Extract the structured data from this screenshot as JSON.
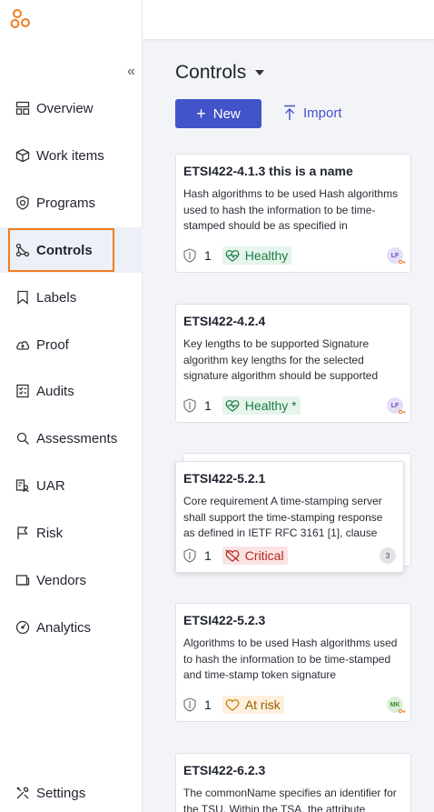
{
  "sidebar": {
    "collapse_label": "«",
    "items": [
      {
        "key": "overview",
        "label": "Overview",
        "icon": "overview-icon"
      },
      {
        "key": "work-items",
        "label": "Work items",
        "icon": "box-icon"
      },
      {
        "key": "programs",
        "label": "Programs",
        "icon": "shield-icon"
      },
      {
        "key": "controls",
        "label": "Controls",
        "icon": "controls-icon",
        "active": true
      },
      {
        "key": "labels",
        "label": "Labels",
        "icon": "bookmark-icon"
      },
      {
        "key": "proof",
        "label": "Proof",
        "icon": "cloud-icon"
      },
      {
        "key": "audits",
        "label": "Audits",
        "icon": "checklist-icon"
      },
      {
        "key": "assessments",
        "label": "Assessments",
        "icon": "search-icon"
      },
      {
        "key": "uar",
        "label": "UAR",
        "icon": "uar-icon"
      },
      {
        "key": "risk",
        "label": "Risk",
        "icon": "flag-icon"
      },
      {
        "key": "vendors",
        "label": "Vendors",
        "icon": "vendors-icon"
      },
      {
        "key": "analytics",
        "label": "Analytics",
        "icon": "analytics-icon"
      },
      {
        "key": "settings",
        "label": "Settings",
        "icon": "settings-icon"
      }
    ]
  },
  "main": {
    "title": "Controls",
    "new_label": "New",
    "import_label": "Import"
  },
  "cards": [
    {
      "title": "ETSI422-4.1.3 this is a name",
      "desc": "Hash algorithms to be used Hash algorithms used to hash the information to be time-stamped should be as specified in",
      "count": "1",
      "status": "Healthy",
      "avatar": "LF"
    },
    {
      "title": "ETSI422-4.2.4",
      "desc": "Key lengths to be supported Signature algorithm key lengths for the selected signature algorithm should be supported",
      "count": "1",
      "status": "Healthy *",
      "avatar": "LF"
    },
    {
      "title": "ETSI422-5.2.1",
      "desc": "Core requirement A time-stamping server shall support the time-stamping response as defined in IETF RFC 3161 [1], clause",
      "count": "1",
      "status": "Critical",
      "avatar": "3"
    },
    {
      "title": "ETSI422-5.2.3",
      "desc": "Algorithms to be used Hash algorithms used to hash the information to be time-stamped and time-stamp token signature",
      "count": "1",
      "status": "At risk",
      "avatar": "MK"
    },
    {
      "title": "ETSI422-6.2.3",
      "desc": "The commonName specifies an identifier for the TSU. Within the TSA, the attribute"
    }
  ],
  "colors": {
    "accent": "#4353c9",
    "active_outline": "#ef7d22",
    "healthy": "#1b7a45",
    "critical": "#b3261e",
    "at_risk": "#9a5b00"
  }
}
